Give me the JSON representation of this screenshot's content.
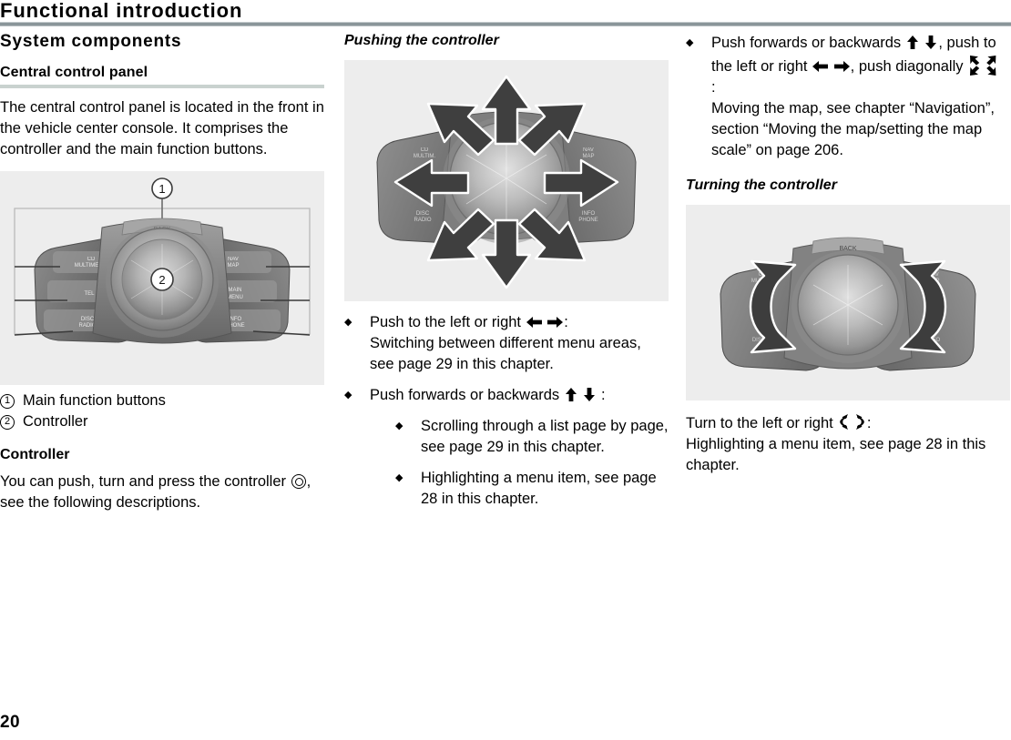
{
  "header": {
    "running_title": "Functional introduction"
  },
  "page_number": "20",
  "column1": {
    "section_title": "System components",
    "subsection_title": "Central control panel",
    "intro_paragraph": "The central control panel is located in the front in the vehicle center console. It comprises the controller and the main function buttons.",
    "figure_caption": "central-control-panel-photo",
    "legend": [
      {
        "number": "1",
        "label": "Main function buttons"
      },
      {
        "number": "2",
        "label": "Controller"
      }
    ],
    "controller_heading": "Controller",
    "controller_text_before": "You can push, turn and press the controller",
    "controller_text_after": ", see the following descriptions."
  },
  "column2": {
    "heading": "Pushing the controller",
    "figure_caption": "pushing-the-controller-photo",
    "bullets": [
      {
        "lead": "Push to the left or right",
        "icons": "left-right-arrows",
        "after": ":",
        "detail": "Switching between different menu areas, see page 29 in this chapter."
      },
      {
        "lead": "Push forwards or backwards",
        "icons": "up-down-arrows",
        "after": ":",
        "sub_bullets": [
          "Scrolling through a list page by page, see page 29 in this chapter.",
          "Highlighting a menu item, see page 28 in this chapter."
        ]
      }
    ]
  },
  "column3": {
    "bullet": {
      "part1": "Push forwards or backwards",
      "icons1": "up-down-arrows",
      "part2": ", push to the left or right",
      "icons2": "left-right-arrows",
      "part3": ", push diagonally",
      "icons3": "four-diagonal-arrows",
      "part4": ":",
      "detail": "Moving the map, see chapter “Navigation”, section “Moving the map/setting the map scale” on page 206."
    },
    "heading": "Turning the controller",
    "figure_caption": "turning-the-controller-photo",
    "turn_text_before": "Turn to the left or right",
    "turn_icons": "rotate-left-right-arrows",
    "turn_text_after": ":",
    "turn_detail": "Highlighting a menu item, see page 28 in this chapter."
  },
  "colors": {
    "header_rule": "#8a9599",
    "subhead_rule": "#c9d2cf",
    "figure_background": "#ededed",
    "text": "#000000"
  }
}
